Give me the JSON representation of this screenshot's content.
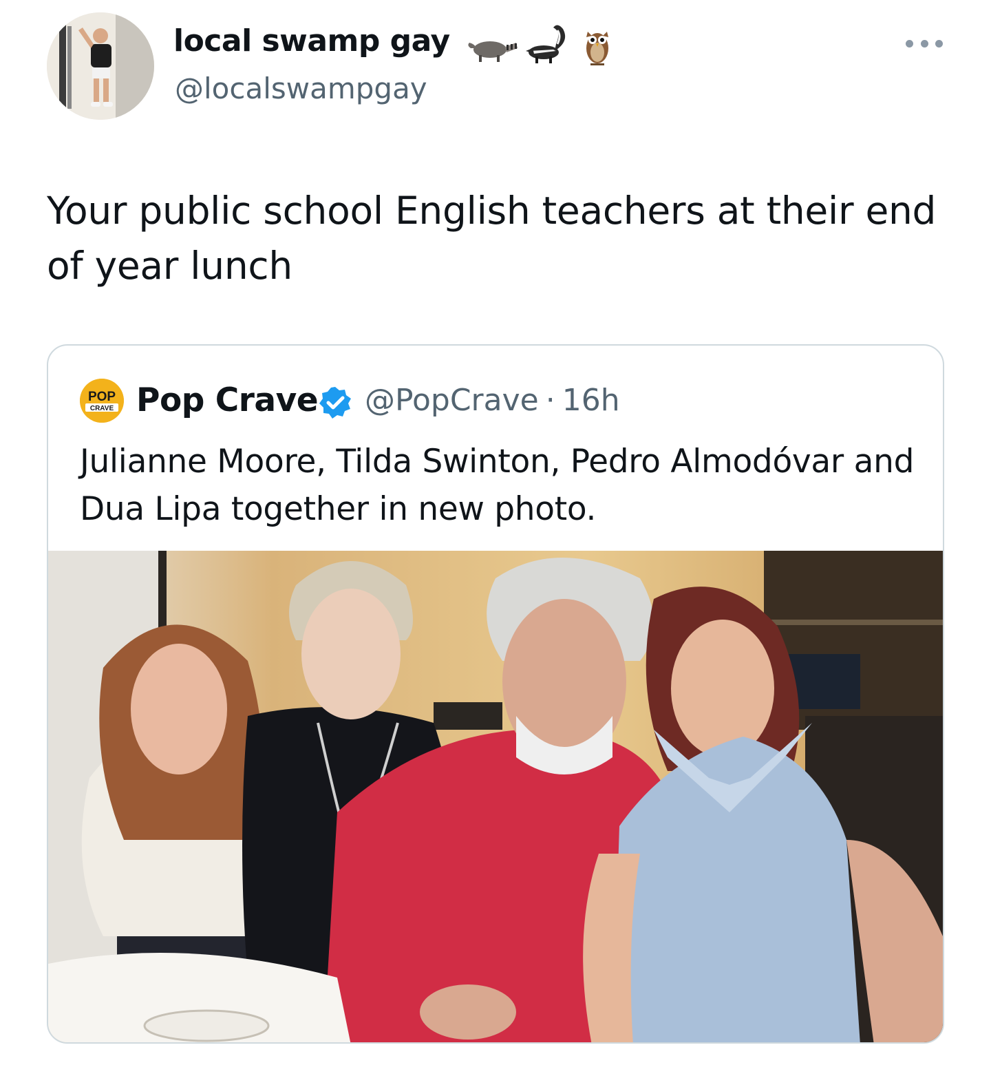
{
  "tweet": {
    "author": {
      "display_name": "local swamp gay",
      "name_emojis": [
        "raccoon-icon",
        "skunk-icon",
        "owl-icon"
      ],
      "handle": "@localswampgay",
      "avatar": "avatar"
    },
    "more_icon": "more-options-icon",
    "text": "Your public school English teachers at their end of year lunch",
    "quoted": {
      "author_name": "Pop Crave",
      "avatar": "pop-crave-logo",
      "avatar_text_top": "POP",
      "avatar_text_bottom": "CRAVE",
      "verified_icon": "verified-badge-icon",
      "handle": "@PopCrave",
      "separator": "·",
      "time": "16h",
      "text": "Julianne Moore, Tilda Swinton, Pedro Almodóvar and Dua Lipa together in new photo.",
      "media": "photo"
    }
  },
  "colors": {
    "text_primary": "#0f1419",
    "text_secondary": "#536471",
    "border": "#cfd9de",
    "verified": "#1d9bf0",
    "logo": "#f3b21b"
  }
}
